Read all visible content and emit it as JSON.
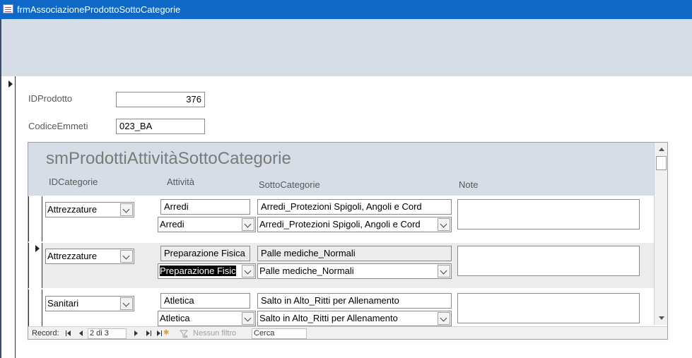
{
  "window": {
    "title": "frmAssociazioneProdottoSottoCategorie"
  },
  "main": {
    "id_label": "IDProdotto",
    "id_value": "376",
    "codice_label": "CodiceEmmeti",
    "codice_value": "023_BA"
  },
  "subform": {
    "title": "smProdottiAttivitàSottoCategorie",
    "headers": {
      "categorie": "IDCategorie",
      "attivita": "Attività",
      "sotto": "SottoCategorie",
      "note": "Note"
    },
    "records": [
      {
        "categoria": "Attrezzature",
        "attivita_text": "Arredi",
        "attivita_combo": "Arredi",
        "sotto_text": "Arredi_Protezioni Spigoli, Angoli e Cord",
        "sotto_combo": "Arredi_Protezioni Spigoli, Angoli e Cord"
      },
      {
        "categoria": "Attrezzature",
        "attivita_text": "Preparazione Fisica",
        "attivita_combo": "Preparazione Fisic",
        "sotto_text": "Palle mediche_Normali",
        "sotto_combo": "Palle mediche_Normali"
      },
      {
        "categoria": "Sanitari",
        "attivita_text": "Atletica",
        "attivita_combo": "Atletica",
        "sotto_text": "Salto in Alto_Ritti per Allenamento",
        "sotto_combo": "Salto in Alto_Ritti per Allenamento"
      }
    ]
  },
  "navigation": {
    "record_label": "Record:",
    "position": "2 di 3",
    "filter_label": "Nessun filtro",
    "search_label": "Cerca"
  }
}
